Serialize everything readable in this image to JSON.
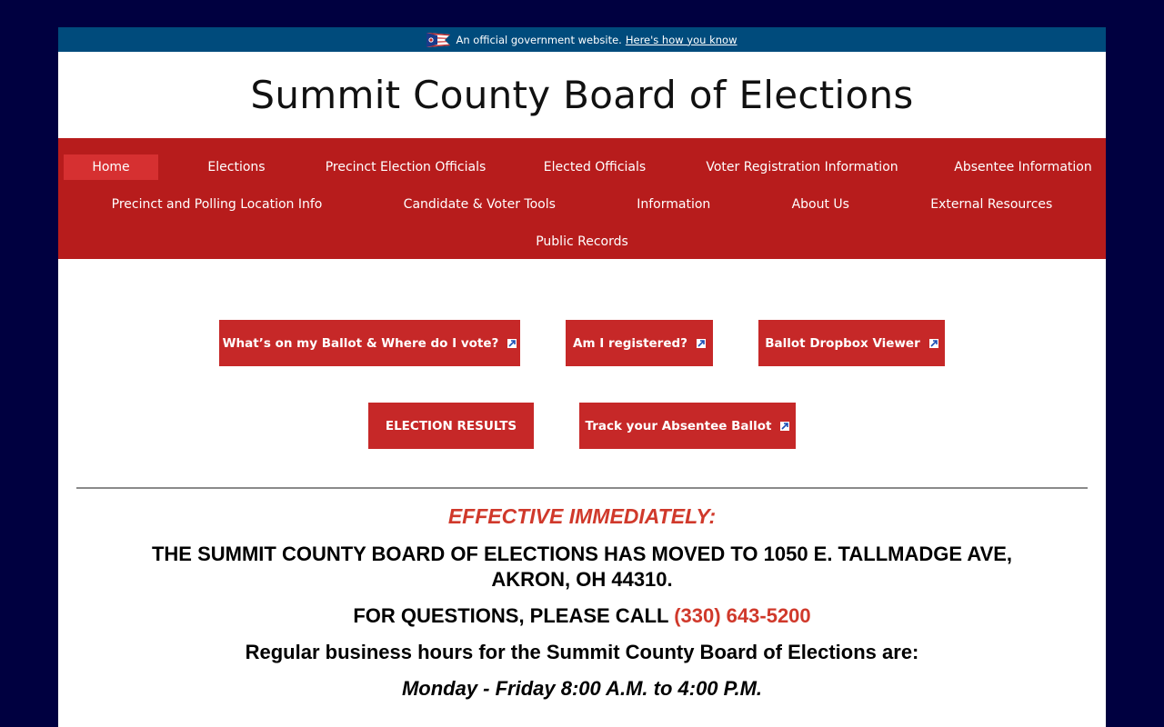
{
  "gov_banner": {
    "text": "An official government website.",
    "link": "Here's how you know",
    "flag_icon": "ohio-flag-icon"
  },
  "site": {
    "title": "Summit County Board of Elections"
  },
  "nav": {
    "row1": [
      "Home",
      "Elections",
      "Precinct Election Officials",
      "Elected Officials",
      "Voter Registration Information",
      "Absentee Information"
    ],
    "row2": [
      "Precinct and Polling Location Info",
      "Candidate & Voter Tools",
      "Information",
      "About Us",
      "External Resources"
    ],
    "row3": [
      "Public Records"
    ],
    "active": "Home"
  },
  "buttons": {
    "ballot": "What’s on my Ballot & Where do I vote?",
    "registered": "Am I registered?",
    "dropbox": "Ballot Dropbox Viewer",
    "results": "ELECTION RESULTS",
    "track": "Track your Absentee Ballot"
  },
  "notice": {
    "effective": "EFFECTIVE IMMEDIATELY:",
    "moved": "THE SUMMIT COUNTY BOARD OF ELECTIONS HAS MOVED TO 1050 E. TALLMADGE AVE, AKRON, OH 44310.",
    "call_prefix": "FOR QUESTIONS, PLEASE CALL",
    "phone": "(330) 643-5200",
    "hours_heading": "Regular business hours for the Summit County Board of Elections are:",
    "hours": "Monday - Friday 8:00 A.M. to 4:00 P.M."
  },
  "colors": {
    "background": "#000040",
    "gov_bar": "#004b7c",
    "nav": "#b71c1c",
    "nav_active": "#d63031",
    "button": "#c62828",
    "accent_text": "#d0392b"
  }
}
